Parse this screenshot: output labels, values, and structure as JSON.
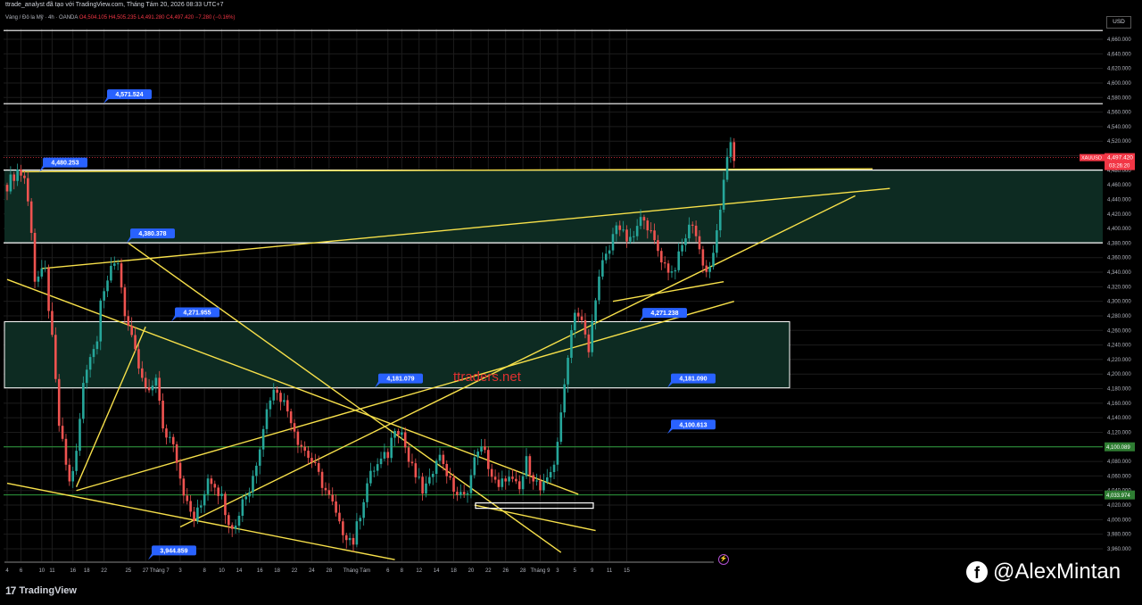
{
  "window": {
    "caption": "ttrade_analyst đã tạo với TradingView.com, Tháng Tám 20, 2026 08:33 UTC+7",
    "symbol_line": "Vàng / Đô la Mỹ · 4h · OANDA",
    "ohlc_line": "O4,504.105 H4,505.235 L4,491.280 C4,497.420 −7.280 (−0.16%)",
    "currency": "USD",
    "brand": "TradingView",
    "social_handle": "@AlexMintan",
    "watermark": "ttraders.net"
  },
  "colors": {
    "background": "#000000",
    "grid": "#1c1c1c",
    "up_candle": "#26a69a",
    "down_candle": "#ef5350",
    "trendline": "#f7e04a",
    "level_line": "#ffffff",
    "support_line": "#2e9e3e",
    "label_bg": "#2962ff",
    "price_badge": "#f23645",
    "zone_fill": "#0d2b22"
  },
  "icons": [
    "facebook-icon",
    "tradingview-logo-icon",
    "lightning-icon"
  ],
  "chart_data": {
    "type": "candlestick",
    "title": "",
    "xlabel": "",
    "ylabel": "",
    "ylim": [
      3940,
      4680
    ],
    "grid": true,
    "y_ticks": [
      "4,660.000",
      "4,640.000",
      "4,620.000",
      "4,600.000",
      "4,580.000",
      "4,560.000",
      "4,540.000",
      "4,520.000",
      "4,480.000",
      "4,460.000",
      "4,440.000",
      "4,420.000",
      "4,400.000",
      "4,380.000",
      "4,360.000",
      "4,340.000",
      "4,320.000",
      "4,300.000",
      "4,280.000",
      "4,260.000",
      "4,240.000",
      "4,220.000",
      "4,200.000",
      "4,180.000",
      "4,160.000",
      "4,140.000",
      "4,120.000",
      "4,080.000",
      "4,060.000",
      "4,040.000",
      "4,020.000",
      "4,000.000",
      "3,980.000",
      "3,960.000"
    ],
    "x_ticks": [
      {
        "label": "4",
        "i": 0
      },
      {
        "label": "6",
        "i": 4
      },
      {
        "label": "10",
        "i": 10
      },
      {
        "label": "11",
        "i": 13
      },
      {
        "label": "16",
        "i": 19
      },
      {
        "label": "18",
        "i": 23
      },
      {
        "label": "22",
        "i": 28
      },
      {
        "label": "25",
        "i": 35
      },
      {
        "label": "27",
        "i": 40
      },
      {
        "label": "Tháng 7",
        "i": 44
      },
      {
        "label": "3",
        "i": 50
      },
      {
        "label": "8",
        "i": 57
      },
      {
        "label": "10",
        "i": 62
      },
      {
        "label": "14",
        "i": 67
      },
      {
        "label": "16",
        "i": 73
      },
      {
        "label": "18",
        "i": 78
      },
      {
        "label": "22",
        "i": 83
      },
      {
        "label": "24",
        "i": 88
      },
      {
        "label": "28",
        "i": 93
      },
      {
        "label": "Tháng Tám",
        "i": 101
      },
      {
        "label": "6",
        "i": 110
      },
      {
        "label": "8",
        "i": 114
      },
      {
        "label": "12",
        "i": 119
      },
      {
        "label": "14",
        "i": 124
      },
      {
        "label": "18",
        "i": 129
      },
      {
        "label": "20",
        "i": 134
      },
      {
        "label": "22",
        "i": 139
      },
      {
        "label": "26",
        "i": 144
      },
      {
        "label": "28",
        "i": 149
      },
      {
        "label": "Tháng 9",
        "i": 154
      },
      {
        "label": "3",
        "i": 159
      },
      {
        "label": "5",
        "i": 164
      },
      {
        "label": "9",
        "i": 169
      },
      {
        "label": "11",
        "i": 174
      },
      {
        "label": "15",
        "i": 179
      }
    ],
    "series": [
      {
        "points": [
          [
            0,
            4460
          ],
          [
            3,
            4480
          ],
          [
            5,
            4470
          ],
          [
            7,
            4400
          ],
          [
            8,
            4330
          ],
          [
            11,
            4340
          ],
          [
            13,
            4245
          ],
          [
            15,
            4130
          ],
          [
            18,
            4050
          ],
          [
            20,
            4090
          ],
          [
            22,
            4185
          ],
          [
            24,
            4230
          ],
          [
            26,
            4245
          ],
          [
            27,
            4310
          ],
          [
            30,
            4340
          ],
          [
            32,
            4356
          ],
          [
            34,
            4285
          ],
          [
            36,
            4245
          ],
          [
            39,
            4190
          ],
          [
            41,
            4170
          ],
          [
            43,
            4200
          ],
          [
            45,
            4120
          ],
          [
            48,
            4110
          ],
          [
            50,
            4060
          ],
          [
            52,
            4020
          ],
          [
            54,
            4000
          ],
          [
            56,
            4020
          ],
          [
            58,
            4060
          ],
          [
            60,
            4050
          ],
          [
            62,
            4030
          ],
          [
            64,
            4000
          ],
          [
            66,
            3990
          ],
          [
            68,
            4030
          ],
          [
            70,
            4040
          ],
          [
            72,
            4080
          ],
          [
            74,
            4130
          ],
          [
            76,
            4170
          ],
          [
            78,
            4180
          ],
          [
            80,
            4160
          ],
          [
            82,
            4140
          ],
          [
            84,
            4110
          ],
          [
            86,
            4095
          ],
          [
            88,
            4080
          ],
          [
            90,
            4060
          ],
          [
            92,
            4040
          ],
          [
            94,
            4020
          ],
          [
            96,
            3990
          ],
          [
            98,
            3980
          ],
          [
            100,
            3970
          ],
          [
            102,
            4010
          ],
          [
            104,
            4050
          ],
          [
            106,
            4070
          ],
          [
            108,
            4080
          ],
          [
            110,
            4090
          ],
          [
            112,
            4130
          ],
          [
            114,
            4120
          ],
          [
            116,
            4080
          ],
          [
            118,
            4060
          ],
          [
            120,
            4040
          ],
          [
            122,
            4050
          ],
          [
            124,
            4090
          ],
          [
            126,
            4080
          ],
          [
            128,
            4050
          ],
          [
            130,
            4035
          ],
          [
            132,
            4030
          ],
          [
            134,
            4060
          ],
          [
            136,
            4100
          ],
          [
            138,
            4090
          ],
          [
            140,
            4060
          ],
          [
            142,
            4040
          ],
          [
            144,
            4060
          ],
          [
            146,
            4050
          ],
          [
            148,
            4040
          ],
          [
            150,
            4080
          ],
          [
            152,
            4060
          ],
          [
            154,
            4040
          ],
          [
            156,
            4050
          ],
          [
            158,
            4080
          ],
          [
            160,
            4140
          ],
          [
            162,
            4230
          ],
          [
            164,
            4290
          ],
          [
            166,
            4270
          ],
          [
            168,
            4230
          ],
          [
            170,
            4310
          ],
          [
            172,
            4350
          ],
          [
            174,
            4370
          ],
          [
            176,
            4410
          ],
          [
            178,
            4390
          ],
          [
            180,
            4380
          ],
          [
            182,
            4400
          ],
          [
            184,
            4420
          ],
          [
            186,
            4390
          ],
          [
            188,
            4370
          ],
          [
            190,
            4350
          ],
          [
            192,
            4340
          ],
          [
            194,
            4360
          ],
          [
            196,
            4390
          ],
          [
            198,
            4410
          ],
          [
            200,
            4370
          ],
          [
            202,
            4340
          ],
          [
            204,
            4360
          ],
          [
            206,
            4430
          ],
          [
            208,
            4490
          ],
          [
            209,
            4520
          ],
          [
            210,
            4497
          ]
        ]
      }
    ],
    "price_labels": [
      {
        "text": "4,571.524",
        "price": 4571.524
      },
      {
        "text": "4,480.253",
        "price": 4480.253
      },
      {
        "text": "4,380.378",
        "price": 4380.378
      },
      {
        "text": "4,271.955",
        "price": 4271.955
      },
      {
        "text": "4,181.079",
        "price": 4181.079
      },
      {
        "text": "3,944.859",
        "price": 3944.859
      },
      {
        "text": "4,271.238",
        "price": 4271.238
      },
      {
        "text": "4,181.090",
        "price": 4181.09
      },
      {
        "text": "4,100.613",
        "price": 4100.613
      }
    ],
    "horizontal_levels": [
      {
        "price": 4672,
        "kind": "level"
      },
      {
        "price": 4571.524,
        "kind": "level"
      },
      {
        "price": 4480.253,
        "kind": "level"
      },
      {
        "price": 4380.378,
        "kind": "level"
      },
      {
        "price": 4100.089,
        "kind": "support",
        "badge": "4,100.089"
      },
      {
        "price": 4033.974,
        "kind": "support",
        "badge": "4,033.974"
      }
    ],
    "zones": [
      {
        "from": 4271.955,
        "to": 4181.079
      },
      {
        "from": 4380.378,
        "to": 4480.253
      }
    ],
    "current_price": {
      "symbol": "XAUUSD",
      "price_text": "4,497.420",
      "countdown": "03:26:20",
      "price": 4497.42
    }
  }
}
